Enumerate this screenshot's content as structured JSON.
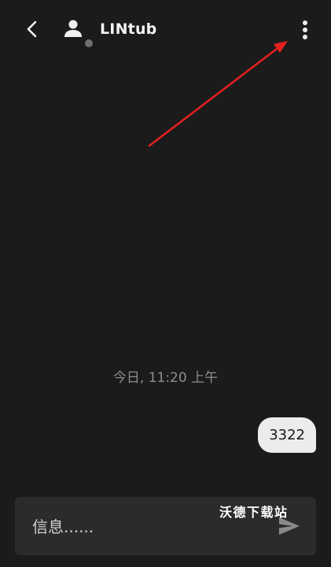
{
  "header": {
    "back_icon": "chevron-left-icon",
    "avatar_icon": "person-icon",
    "contact_name": "LINtub",
    "more_icon": "more-vertical-icon"
  },
  "annotation": {
    "arrow_color": "#e62020"
  },
  "conversation": {
    "timestamp": "今日, 11:20 上午",
    "messages": [
      {
        "direction": "outgoing",
        "text": "3322"
      }
    ]
  },
  "composer": {
    "placeholder": "信息......",
    "value": "",
    "send_icon": "send-icon"
  },
  "watermark": {
    "text": "沃德下载站"
  },
  "colors": {
    "background": "#1c1b1c",
    "composer": "#2c2b2c",
    "bubble": "#ececec"
  }
}
